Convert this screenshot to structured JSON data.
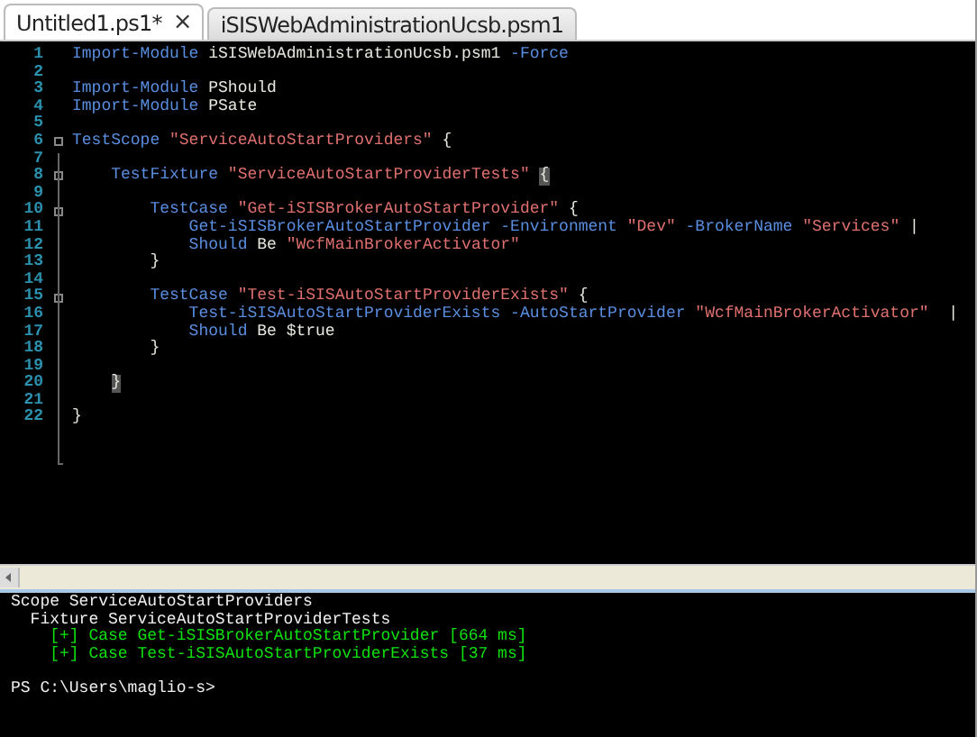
{
  "tabs": [
    {
      "label": "Untitled1.ps1*",
      "selected": true,
      "close": "×"
    },
    {
      "label": "iSISWebAdministrationUcsb.psm1",
      "selected": false
    }
  ],
  "editor": {
    "lines": [
      {
        "n": "1",
        "fold": false,
        "tokens": [
          {
            "kind": "command",
            "text": "Import-Module"
          },
          {
            "kind": "plain",
            "text": " iSISWebAdministrationUcsb.psm1 "
          },
          {
            "kind": "param",
            "text": "-Force"
          }
        ]
      },
      {
        "n": "2",
        "fold": false
      },
      {
        "n": "3",
        "fold": false,
        "tokens": [
          {
            "kind": "command",
            "text": "Import-Module"
          },
          {
            "kind": "plain",
            "text": " PShould"
          }
        ]
      },
      {
        "n": "4",
        "fold": false,
        "tokens": [
          {
            "kind": "command",
            "text": "Import-Module"
          },
          {
            "kind": "plain",
            "text": " PSate"
          }
        ]
      },
      {
        "n": "5",
        "fold": false
      },
      {
        "n": "6",
        "fold": true,
        "tokens": [
          {
            "kind": "command",
            "text": "TestScope"
          },
          {
            "kind": "string",
            "text": " \"ServiceAutoStartProviders\""
          },
          {
            "kind": "plain",
            "text": " {"
          }
        ]
      },
      {
        "n": "7",
        "fold": false
      },
      {
        "n": "8",
        "fold": true,
        "tokens": [
          {
            "kind": "command",
            "text": "    TestFixture"
          },
          {
            "kind": "string",
            "text": " \"ServiceAutoStartProviderTests\" "
          },
          {
            "kind": "match",
            "text": "{"
          }
        ]
      },
      {
        "n": "9",
        "fold": false
      },
      {
        "n": "10",
        "fold": true,
        "tokens": [
          {
            "kind": "command",
            "text": "        TestCase"
          },
          {
            "kind": "string",
            "text": " \"Get-iSISBrokerAutoStartProvider\""
          },
          {
            "kind": "plain",
            "text": " {"
          }
        ]
      },
      {
        "n": "11",
        "fold": false,
        "tokens": [
          {
            "kind": "command",
            "text": "            Get-iSISBrokerAutoStartProvider"
          },
          {
            "kind": "param",
            "text": " -Environment"
          },
          {
            "kind": "string",
            "text": " \"Dev\""
          },
          {
            "kind": "param",
            "text": " -BrokerName"
          },
          {
            "kind": "string",
            "text": " \"Services\""
          },
          {
            "kind": "plain",
            "text": " |"
          }
        ]
      },
      {
        "n": "12",
        "fold": false,
        "tokens": [
          {
            "kind": "command",
            "text": "            Should"
          },
          {
            "kind": "plain",
            "text": " Be "
          },
          {
            "kind": "string",
            "text": "\"WcfMainBrokerActivator\""
          }
        ]
      },
      {
        "n": "13",
        "fold": false,
        "tokens": [
          {
            "kind": "plain",
            "text": "        }"
          }
        ]
      },
      {
        "n": "14",
        "fold": false
      },
      {
        "n": "15",
        "fold": true,
        "tokens": [
          {
            "kind": "command",
            "text": "        TestCase"
          },
          {
            "kind": "string",
            "text": " \"Test-iSISAutoStartProviderExists\""
          },
          {
            "kind": "plain",
            "text": " {"
          }
        ]
      },
      {
        "n": "16",
        "fold": false,
        "tokens": [
          {
            "kind": "command",
            "text": "            Test-iSISAutoStartProviderExists"
          },
          {
            "kind": "param",
            "text": " -AutoStartProvider"
          },
          {
            "kind": "string",
            "text": " \"WcfMainBrokerActivator\""
          },
          {
            "kind": "plain",
            "text": "  |"
          }
        ]
      },
      {
        "n": "17",
        "fold": false,
        "tokens": [
          {
            "kind": "command",
            "text": "            Should"
          },
          {
            "kind": "plain",
            "text": " Be $true"
          }
        ]
      },
      {
        "n": "18",
        "fold": false,
        "tokens": [
          {
            "kind": "plain",
            "text": "        }"
          }
        ]
      },
      {
        "n": "19",
        "fold": false
      },
      {
        "n": "20",
        "fold": false,
        "tokens": [
          {
            "kind": "match",
            "text": "    }"
          }
        ]
      },
      {
        "n": "21",
        "fold": false
      },
      {
        "n": "22",
        "fold": false,
        "tokens": [
          {
            "kind": "plain",
            "text": "}"
          }
        ]
      }
    ]
  },
  "output": {
    "lines": [
      {
        "text": "Scope ServiceAutoStartProviders",
        "kind": "info"
      },
      {
        "text": "  Fixture ServiceAutoStartProviderTests",
        "kind": "info"
      },
      {
        "text": "    [+] Case Get-iSISBrokerAutoStartProvider [664 ms]",
        "kind": "pass"
      },
      {
        "text": "    [+] Case Test-iSISAutoStartProviderExists [37 ms]",
        "kind": "pass"
      },
      {
        "kind": "blank"
      },
      {
        "text": "PS C:\\Users\\maglio-s>",
        "kind": "info"
      }
    ]
  }
}
